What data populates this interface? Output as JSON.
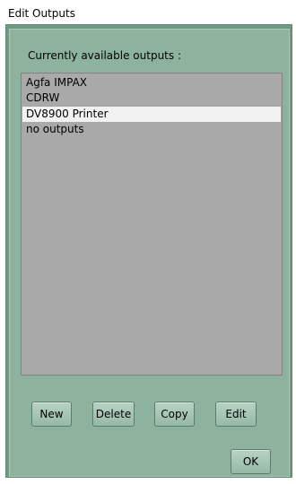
{
  "window": {
    "title": "Edit Outputs"
  },
  "outputs_section": {
    "label": "Currently available outputs :",
    "items": [
      {
        "label": "Agfa IMPAX",
        "selected": false
      },
      {
        "label": "CDRW",
        "selected": false
      },
      {
        "label": "DV8900 Printer",
        "selected": true
      },
      {
        "label": "no outputs",
        "selected": false
      }
    ]
  },
  "buttons": {
    "new_label": "New",
    "delete_label": "Delete",
    "copy_label": "Copy",
    "edit_label": "Edit",
    "ok_label": "OK"
  },
  "colors": {
    "frame_background": "#8db39f",
    "list_background": "#a9a9a9",
    "selected_item_background": "#f2f2f2"
  }
}
